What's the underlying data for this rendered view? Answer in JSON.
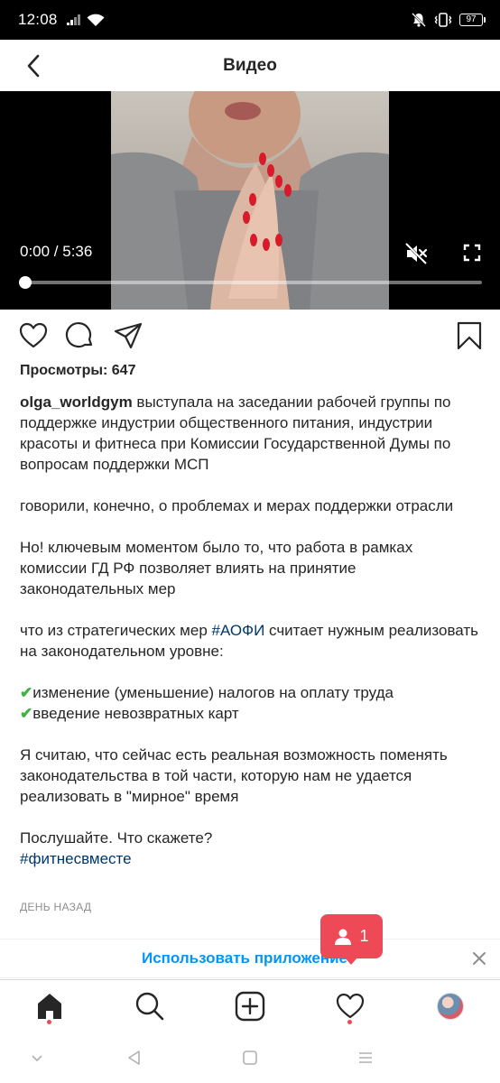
{
  "status_bar": {
    "time": "12:08",
    "battery": "97",
    "icons": [
      "signal-icon",
      "wifi-icon",
      "mute-notifications-icon",
      "vibrate-icon",
      "battery-icon"
    ]
  },
  "header": {
    "title": "Видео",
    "back_icon": "chevron-left-icon"
  },
  "video": {
    "time": "0:00 / 5:36",
    "progress": 0.0,
    "muted": true,
    "icons": [
      "muted-speaker-icon",
      "fullscreen-icon"
    ]
  },
  "actions": {
    "icons": [
      "heart-icon",
      "comment-icon",
      "share-icon",
      "bookmark-icon"
    ]
  },
  "views": "Просмотры: 647",
  "post": {
    "username": "olga_worldgym",
    "para1": "выступала на заседании рабочей группы по поддержке индустрии общественного питания, индустрии красоты и фитнеса при Комиссии Государственной Думы по вопросам поддержки МСП",
    "para2": "говорили, конечно, о проблемах и мерах поддержки отрасли",
    "para3": "Но! ключевым моментом было то, что работа в рамках комиссии ГД РФ позволяет влиять на принятие законодательных мер",
    "para4_before": "что из стратегических мер ",
    "para4_tag": "#АОФИ",
    "para4_after": " считает нужным реализовать на законодательном уровне:",
    "check_mark": "✔",
    "bullet1": "изменение (уменьшение) налогов на оплату труда",
    "bullet2": "введение невозвратных карт",
    "para5": "Я считаю, что сейчас есть реальная возможность поменять законодательства в той части, которую нам не удается реализовать в \"мирное\" время",
    "para6": "Послушайте. Что скажете?",
    "hashtag": "#фитнесвместе",
    "date": "ДЕНЬ НАЗАД"
  },
  "banner": {
    "text": "Использовать приложение",
    "close_icon": "close-icon"
  },
  "notification": {
    "count": "1",
    "icon": "person-icon",
    "color": "#ed4956"
  },
  "bottom_nav": {
    "items": [
      "home-icon",
      "search-icon",
      "new-post-icon",
      "activity-heart-icon",
      "profile-avatar"
    ]
  },
  "system_nav": {
    "items": [
      "hide-keyboard-icon",
      "back-icon",
      "home-icon",
      "recents-icon"
    ]
  },
  "colors": {
    "link": "#00376b",
    "accent": "#0095f6",
    "badge": "#ed4956",
    "text": "#262626",
    "muted": "#8e8e8e"
  }
}
